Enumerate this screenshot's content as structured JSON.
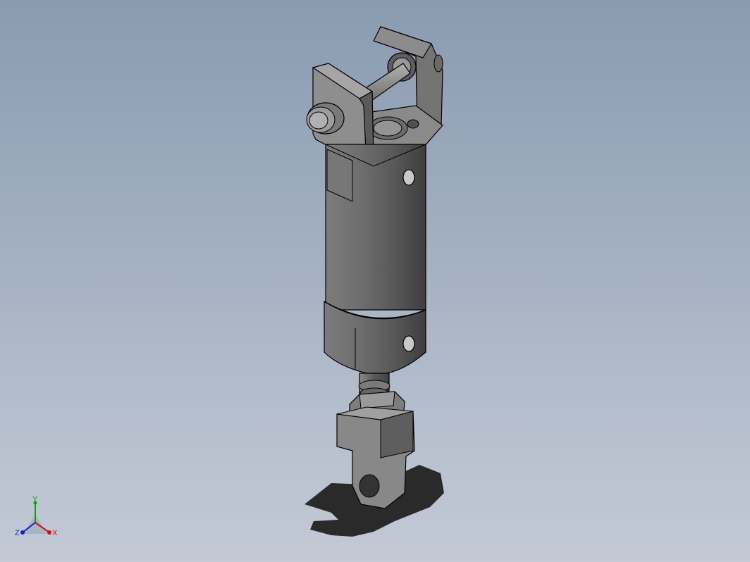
{
  "viewport": {
    "background_top": "#8a9bb0",
    "background_bottom": "#c3c9d5",
    "model_name": "",
    "part_color": "#6f6f6f",
    "edge_color": "#000000"
  },
  "triad": {
    "x_label": "X",
    "y_label": "Y",
    "z_label": "Z",
    "x_color": "#d01010",
    "y_color": "#10a010",
    "z_color": "#1020d0"
  }
}
